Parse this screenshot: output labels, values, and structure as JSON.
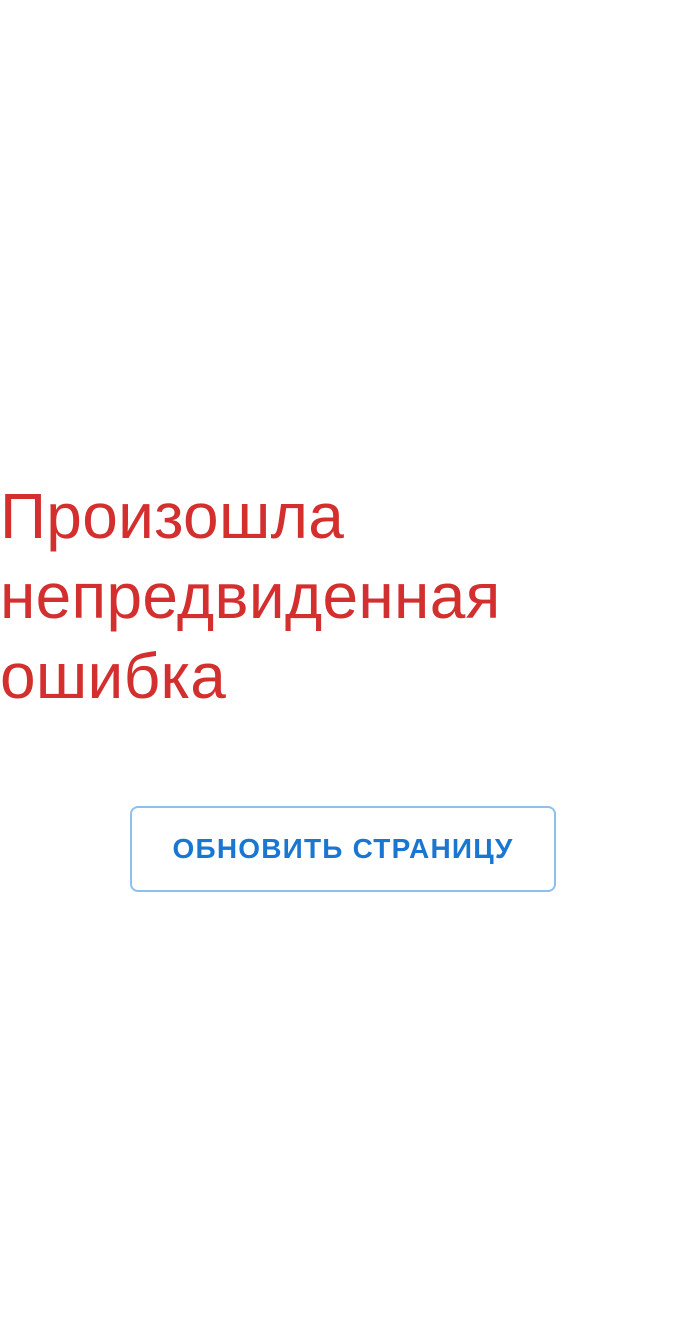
{
  "error": {
    "title": "Произошла непредвиденная ошибка"
  },
  "actions": {
    "reload_label": "ОБНОВИТЬ СТРАНИЦУ"
  },
  "colors": {
    "error_text": "#d32f2f",
    "button_text": "#1976d2",
    "button_border": "#90bfe9",
    "background": "#ffffff"
  }
}
